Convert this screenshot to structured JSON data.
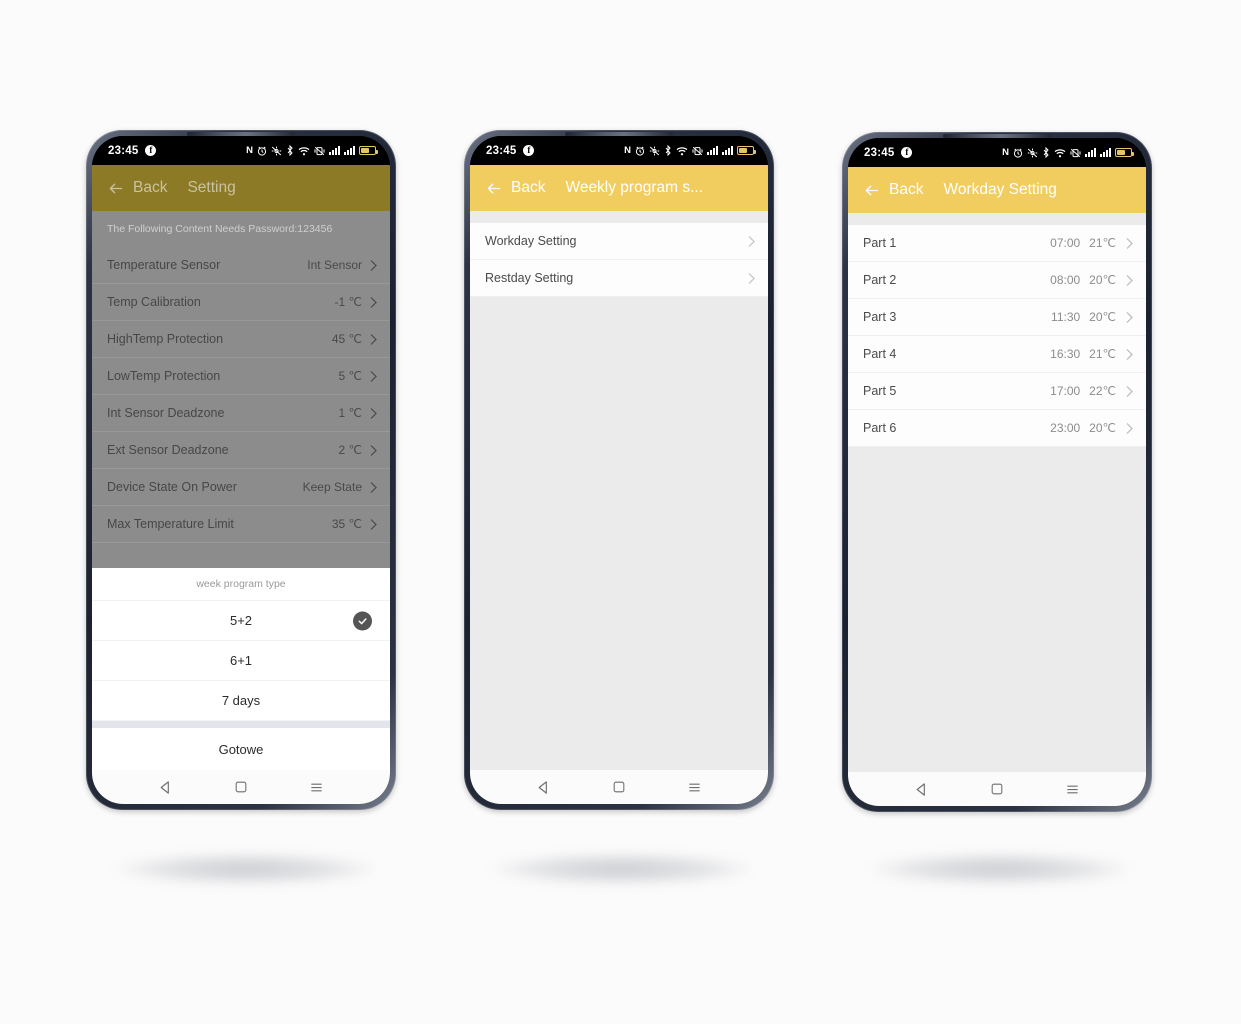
{
  "theme": {
    "accent_yellow": "#f0cd5e",
    "accent_dim": "#8c7a26",
    "page_bg": "#ebebeb",
    "canvas_bg": "#fbfbfb"
  },
  "status_bar": {
    "time": "23:45",
    "app_badge": "f",
    "icons": [
      "nfc-icon",
      "alarm-clock-icon",
      "location-off-icon",
      "bluetooth-icon",
      "wifi-icon",
      "vibrate-icon",
      "signal-bars-icon",
      "signal-bars-icon",
      "battery-icon"
    ]
  },
  "nav_bar": {
    "back": "back-triangle-icon",
    "home": "home-square-icon",
    "recents": "menu-lines-icon"
  },
  "phone1": {
    "header": {
      "back_label": "Back",
      "title": "Setting"
    },
    "password_hint": "The Following Content Needs Password:123456",
    "rows": [
      {
        "label": "Temperature Sensor",
        "value": "Int Sensor"
      },
      {
        "label": "Temp Calibration",
        "value": "-1  ℃"
      },
      {
        "label": "HighTemp Protection",
        "value": "45  ℃"
      },
      {
        "label": "LowTemp Protection",
        "value": "5  ℃"
      },
      {
        "label": "Int Sensor Deadzone",
        "value": "1  ℃"
      },
      {
        "label": "Ext Sensor Deadzone",
        "value": "2  ℃"
      },
      {
        "label": "Device State On Power",
        "value": "Keep State"
      },
      {
        "label": "Max Temperature Limit",
        "value": "35  ℃"
      }
    ],
    "sheet": {
      "title": "week program type",
      "options": [
        {
          "label": "5+2",
          "selected": true
        },
        {
          "label": "6+1",
          "selected": false
        },
        {
          "label": "7 days",
          "selected": false
        }
      ],
      "confirm_label": "Gotowe"
    }
  },
  "phone2": {
    "header": {
      "back_label": "Back",
      "title": "Weekly program s..."
    },
    "rows": [
      {
        "label": "Workday Setting"
      },
      {
        "label": "Restday Setting"
      }
    ]
  },
  "phone3": {
    "header": {
      "back_label": "Back",
      "title": "Workday Setting"
    },
    "rows": [
      {
        "label": "Part 1",
        "time": "07:00",
        "temp": "21℃"
      },
      {
        "label": "Part 2",
        "time": "08:00",
        "temp": "20℃"
      },
      {
        "label": "Part 3",
        "time": "11:30",
        "temp": "20℃"
      },
      {
        "label": "Part 4",
        "time": "16:30",
        "temp": "21℃"
      },
      {
        "label": "Part 5",
        "time": "17:00",
        "temp": "22℃"
      },
      {
        "label": "Part 6",
        "time": "23:00",
        "temp": "20℃"
      }
    ]
  }
}
